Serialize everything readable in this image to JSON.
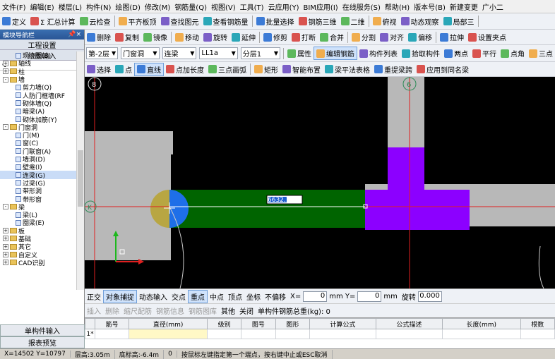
{
  "menubar": {
    "items": [
      "文件(F)",
      "编辑(E)",
      "楼层(L)",
      "构件(N)",
      "绘图(D)",
      "修改(M)",
      "钢筋量(Q)",
      "视图(V)",
      "工具(T)",
      "云应用(Y)",
      "BIM应用(I)",
      "在线服务(S)",
      "帮助(H)",
      "版本号(B)",
      "新建变更",
      "广小二"
    ]
  },
  "toolbar1": {
    "items": [
      "定义",
      "Σ 汇总计算",
      "云检查",
      "平齐板顶",
      "查找图元",
      "查看钢筋量",
      "批量选择",
      "钢筋三维",
      "二维",
      "俯视",
      "动态观察",
      "局部三"
    ]
  },
  "toolbar2": {
    "items": [
      "删除",
      "复制",
      "镜像",
      "移动",
      "旋转",
      "延伸",
      "修剪",
      "打断",
      "合并",
      "分割",
      "对齐",
      "偏移",
      "拉伸",
      "设置夹点"
    ]
  },
  "toolbar3": {
    "floor": "第-2层",
    "category": "门窗洞",
    "type": "连梁",
    "name": "LL1a",
    "layer": "分层1",
    "items": [
      "属性",
      "编辑钢筋",
      "构件列表",
      "拾取构件",
      "两点",
      "平行",
      "点角",
      "三点"
    ]
  },
  "toolbar4": {
    "items": [
      "选择",
      "点",
      "直线",
      "点加长度",
      "三点画弧",
      "矩形",
      "智能布置",
      "梁平法表格",
      "重提梁跨",
      "应用到同名梁"
    ]
  },
  "nav": {
    "title": "模块导航栏",
    "pin": "ᵖ",
    "close": "×",
    "project_settings": "工程设置",
    "drawing_input": "绘图输入",
    "single_component": "单构件输入",
    "report": "报表预览"
  },
  "tree": [
    {
      "label": "现浇板(B)",
      "depth": 2,
      "kind": "item"
    },
    {
      "label": "轴线",
      "depth": 1,
      "kind": "folder",
      "exp": "+"
    },
    {
      "label": "柱",
      "depth": 1,
      "kind": "folder",
      "exp": "+"
    },
    {
      "label": "墙",
      "depth": 1,
      "kind": "folder",
      "exp": "-"
    },
    {
      "label": "剪力墙(Q)",
      "depth": 2,
      "kind": "item"
    },
    {
      "label": "人防门框墙(RF",
      "depth": 2,
      "kind": "item"
    },
    {
      "label": "砌体墙(Q)",
      "depth": 2,
      "kind": "item"
    },
    {
      "label": "暗梁(A)",
      "depth": 2,
      "kind": "item"
    },
    {
      "label": "砌体加筋(Y)",
      "depth": 2,
      "kind": "item"
    },
    {
      "label": "门窗洞",
      "depth": 1,
      "kind": "folder",
      "exp": "-"
    },
    {
      "label": "门(M)",
      "depth": 2,
      "kind": "item"
    },
    {
      "label": "窗(C)",
      "depth": 2,
      "kind": "item"
    },
    {
      "label": "门联窗(A)",
      "depth": 2,
      "kind": "item"
    },
    {
      "label": "墙洞(D)",
      "depth": 2,
      "kind": "item"
    },
    {
      "label": "壁龛(I)",
      "depth": 2,
      "kind": "item"
    },
    {
      "label": "连梁(G)",
      "depth": 2,
      "kind": "item",
      "selected": true
    },
    {
      "label": "过梁(G)",
      "depth": 2,
      "kind": "item"
    },
    {
      "label": "带形洞",
      "depth": 2,
      "kind": "item"
    },
    {
      "label": "带形窗",
      "depth": 2,
      "kind": "item"
    },
    {
      "label": "梁",
      "depth": 1,
      "kind": "folder",
      "exp": "-"
    },
    {
      "label": "梁(L)",
      "depth": 2,
      "kind": "item"
    },
    {
      "label": "圈梁(E)",
      "depth": 2,
      "kind": "item"
    },
    {
      "label": "板",
      "depth": 1,
      "kind": "folder",
      "exp": "+"
    },
    {
      "label": "基础",
      "depth": 1,
      "kind": "folder",
      "exp": "+"
    },
    {
      "label": "其它",
      "depth": 1,
      "kind": "folder",
      "exp": "+"
    },
    {
      "label": "自定义",
      "depth": 1,
      "kind": "folder",
      "exp": "+"
    },
    {
      "label": "CAD识别",
      "depth": 1,
      "kind": "folder",
      "exp": "+"
    }
  ],
  "canvas": {
    "axis_top_1": "8",
    "axis_top_2": "6",
    "axis_left": "K",
    "dimension_value": "6632.189"
  },
  "snapbar": {
    "items": [
      "正交",
      "对象捕捉",
      "动态输入",
      "交点",
      "重点",
      "中点",
      "顶点",
      "坐标",
      "不偏移"
    ],
    "x_label": "X=",
    "x_value": "0",
    "y_label": "mm Y=",
    "y_value": "0",
    "mm": "mm",
    "rotate": "旋转",
    "rotate_value": "0.000"
  },
  "grid_toolbar": {
    "items": [
      "插入",
      "删除",
      "缩尺配筋",
      "钢筋信息",
      "钢筋图库",
      "其他",
      "关闭"
    ],
    "total_label": "单构件钢筋总重(kg): 0"
  },
  "grid": {
    "columns": [
      "筋号",
      "直径(mm)",
      "级别",
      "图号",
      "图形",
      "计算公式",
      "公式描述",
      "长度(mm)",
      "根数"
    ],
    "row_num": "1*"
  },
  "status": {
    "coords": "X=14502 Y=10797",
    "floor_height": "层高:3.05m",
    "base_height": "底标高:-6.4m",
    "value": "0",
    "hint": "按鼠标左键指定第一个端点，按右键中止或ESC取消"
  }
}
